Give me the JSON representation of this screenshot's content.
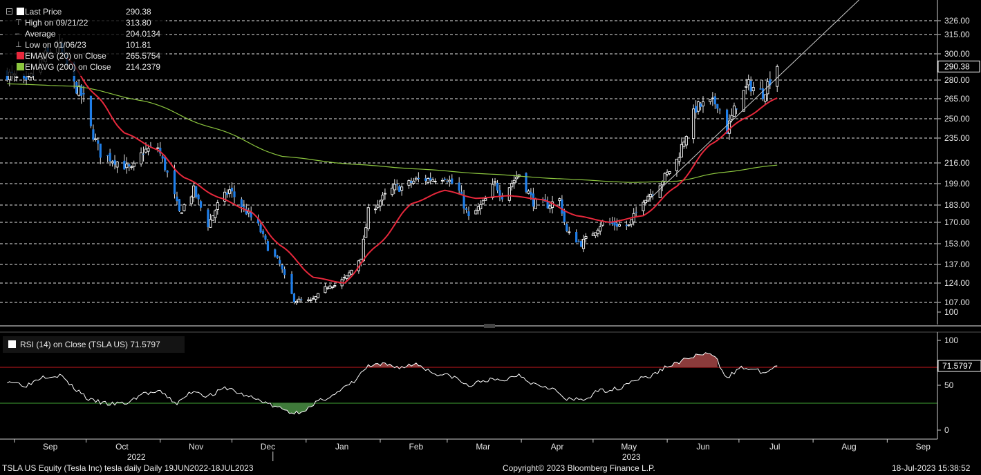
{
  "chart_data": [
    {
      "type": "candlestick",
      "series_name": "TSLA US Equity (Tesla Inc) tesla daily",
      "ylim": [
        95,
        336
      ],
      "y_ticks": [
        100,
        107,
        124,
        137,
        153,
        170,
        183,
        199,
        216,
        235,
        250,
        265,
        280,
        300,
        315,
        326
      ],
      "y_tick_labels": [
        "100",
        "107.00",
        "124.00",
        "137.00",
        "153.00",
        "170.00",
        "183.00",
        "199.00",
        "216.00",
        "235.00",
        "250.00",
        "265.00",
        "280.00",
        "300.00",
        "315.00",
        "326.00"
      ],
      "dashed_grid_levels": [
        107,
        124,
        137,
        153,
        170,
        183,
        199,
        216,
        235,
        250,
        265,
        280,
        300,
        315,
        326
      ],
      "last_price_label": "290.38",
      "legend": [
        {
          "label": "Last Price",
          "value": "290.38",
          "color": "#ffffff"
        },
        {
          "label": "High on 09/21/22",
          "value": "313.80"
        },
        {
          "label": "Average",
          "value": "204.0134"
        },
        {
          "label": "Low on 01/06/23",
          "value": "101.81"
        },
        {
          "label": "EMAVG (20)  on Close",
          "value": "265.5754",
          "color": "#e8283c"
        },
        {
          "label": "EMAVG (200)  on Close",
          "value": "214.2379",
          "color": "#8cc63f"
        }
      ],
      "close_anchors": [
        [
          "2022-08-29",
          285
        ],
        [
          "2022-09-06",
          276
        ],
        [
          "2022-09-13",
          296
        ],
        [
          "2022-09-19",
          308
        ],
        [
          "2022-09-21",
          300
        ],
        [
          "2022-09-26",
          276
        ],
        [
          "2022-09-30",
          265
        ],
        [
          "2022-10-03",
          242
        ],
        [
          "2022-10-07",
          223
        ],
        [
          "2022-10-13",
          218
        ],
        [
          "2022-10-20",
          210
        ],
        [
          "2022-10-25",
          225
        ],
        [
          "2022-10-31",
          228
        ],
        [
          "2022-11-04",
          207
        ],
        [
          "2022-11-09",
          177
        ],
        [
          "2022-11-15",
          194
        ],
        [
          "2022-11-21",
          168
        ],
        [
          "2022-11-25",
          183
        ],
        [
          "2022-11-30",
          194
        ],
        [
          "2022-12-06",
          180
        ],
        [
          "2022-12-12",
          167
        ],
        [
          "2022-12-16",
          150
        ],
        [
          "2022-12-21",
          137
        ],
        [
          "2022-12-27",
          109
        ],
        [
          "2023-01-03",
          108
        ],
        [
          "2023-01-06",
          113
        ],
        [
          "2023-01-11",
          123
        ],
        [
          "2023-01-13",
          122
        ],
        [
          "2023-01-18",
          128
        ],
        [
          "2023-01-24",
          143
        ],
        [
          "2023-01-27",
          178
        ],
        [
          "2023-02-02",
          188
        ],
        [
          "2023-02-07",
          196
        ],
        [
          "2023-02-10",
          196
        ],
        [
          "2023-02-16",
          202
        ],
        [
          "2023-02-23",
          203
        ],
        [
          "2023-02-28",
          205
        ],
        [
          "2023-03-06",
          193
        ],
        [
          "2023-03-10",
          173
        ],
        [
          "2023-03-16",
          184
        ],
        [
          "2023-03-21",
          199
        ],
        [
          "2023-03-24",
          190
        ],
        [
          "2023-03-31",
          207
        ],
        [
          "2023-04-06",
          185
        ],
        [
          "2023-04-12",
          183
        ],
        [
          "2023-04-17",
          187
        ],
        [
          "2023-04-20",
          162
        ],
        [
          "2023-04-26",
          153
        ],
        [
          "2023-05-01",
          162
        ],
        [
          "2023-05-05",
          170
        ],
        [
          "2023-05-11",
          168
        ],
        [
          "2023-05-16",
          167
        ],
        [
          "2023-05-22",
          188
        ],
        [
          "2023-05-26",
          193
        ],
        [
          "2023-06-01",
          207
        ],
        [
          "2023-06-05",
          218
        ],
        [
          "2023-06-08",
          234
        ],
        [
          "2023-06-13",
          258
        ],
        [
          "2023-06-16",
          260
        ],
        [
          "2023-06-22",
          262
        ],
        [
          "2023-06-26",
          241
        ],
        [
          "2023-06-30",
          261
        ],
        [
          "2023-07-05",
          276
        ],
        [
          "2023-07-07",
          274
        ],
        [
          "2023-07-11",
          269
        ],
        [
          "2023-07-13",
          277
        ],
        [
          "2023-07-17",
          290.38
        ]
      ],
      "ema20_anchors": [
        [
          "2022-09-23",
          297
        ],
        [
          "2022-10-05",
          268
        ],
        [
          "2022-10-17",
          239
        ],
        [
          "2022-10-31",
          226
        ],
        [
          "2022-11-11",
          204
        ],
        [
          "2022-11-25",
          189
        ],
        [
          "2022-12-09",
          178
        ],
        [
          "2022-12-21",
          152
        ],
        [
          "2023-01-04",
          128
        ],
        [
          "2023-01-17",
          124
        ],
        [
          "2023-01-31",
          152
        ],
        [
          "2023-02-14",
          184
        ],
        [
          "2023-02-28",
          194
        ],
        [
          "2023-03-13",
          188
        ],
        [
          "2023-03-27",
          190
        ],
        [
          "2023-04-10",
          187
        ],
        [
          "2023-04-24",
          175
        ],
        [
          "2023-05-08",
          170
        ],
        [
          "2023-05-22",
          175
        ],
        [
          "2023-06-05",
          197
        ],
        [
          "2023-06-19",
          230
        ],
        [
          "2023-07-03",
          250
        ],
        [
          "2023-07-17",
          265.5754
        ]
      ],
      "ema200_anchors": [
        [
          "2022-08-29",
          277
        ],
        [
          "2022-09-27",
          275
        ],
        [
          "2022-10-26",
          263
        ],
        [
          "2022-11-23",
          243
        ],
        [
          "2022-12-22",
          221
        ],
        [
          "2023-01-20",
          215
        ],
        [
          "2023-02-17",
          211
        ],
        [
          "2023-03-17",
          207
        ],
        [
          "2023-04-17",
          203
        ],
        [
          "2023-05-17",
          200
        ],
        [
          "2023-06-05",
          201
        ],
        [
          "2023-06-23",
          208
        ],
        [
          "2023-07-17",
          214.2379
        ]
      ],
      "trendline": [
        [
          "2023-05-22",
          183
        ],
        [
          "2023-07-17",
          282
        ],
        [
          "2023-08-22",
          345
        ]
      ]
    },
    {
      "type": "line",
      "series_name": "RSI (14)  on Close (TSLA US) 71.5797",
      "ylim": [
        -5,
        105
      ],
      "y_ticks": [
        0,
        50,
        100
      ],
      "y_tick_labels": [
        "0",
        "50",
        "100"
      ],
      "overbought": 70,
      "oversold": 30,
      "last_value_label": "71.5797",
      "anchors": [
        [
          "2022-08-29",
          55
        ],
        [
          "2022-09-06",
          50
        ],
        [
          "2022-09-13",
          60
        ],
        [
          "2022-09-20",
          61
        ],
        [
          "2022-09-27",
          45
        ],
        [
          "2022-10-03",
          33
        ],
        [
          "2022-10-11",
          29
        ],
        [
          "2022-10-18",
          30
        ],
        [
          "2022-10-25",
          41
        ],
        [
          "2022-11-01",
          42
        ],
        [
          "2022-11-08",
          30
        ],
        [
          "2022-11-15",
          44
        ],
        [
          "2022-11-21",
          38
        ],
        [
          "2022-11-29",
          47
        ],
        [
          "2022-12-06",
          39
        ],
        [
          "2022-12-13",
          33
        ],
        [
          "2022-12-20",
          25
        ],
        [
          "2022-12-27",
          19
        ],
        [
          "2023-01-03",
          25
        ],
        [
          "2023-01-06",
          32
        ],
        [
          "2023-01-13",
          40
        ],
        [
          "2023-01-20",
          52
        ],
        [
          "2023-01-27",
          71
        ],
        [
          "2023-02-03",
          73
        ],
        [
          "2023-02-10",
          70
        ],
        [
          "2023-02-16",
          74
        ],
        [
          "2023-02-24",
          63
        ],
        [
          "2023-03-03",
          60
        ],
        [
          "2023-03-10",
          49
        ],
        [
          "2023-03-17",
          56
        ],
        [
          "2023-03-24",
          55
        ],
        [
          "2023-03-31",
          62
        ],
        [
          "2023-04-06",
          52
        ],
        [
          "2023-04-13",
          48
        ],
        [
          "2023-04-20",
          34
        ],
        [
          "2023-04-27",
          34
        ],
        [
          "2023-05-04",
          44
        ],
        [
          "2023-05-11",
          46
        ],
        [
          "2023-05-18",
          56
        ],
        [
          "2023-05-25",
          60
        ],
        [
          "2023-06-01",
          71
        ],
        [
          "2023-06-08",
          78
        ],
        [
          "2023-06-14",
          84
        ],
        [
          "2023-06-20",
          84
        ],
        [
          "2023-06-26",
          60
        ],
        [
          "2023-07-03",
          70
        ],
        [
          "2023-07-07",
          67
        ],
        [
          "2023-07-12",
          64
        ],
        [
          "2023-07-17",
          71.5797
        ]
      ]
    }
  ],
  "x_axis": {
    "month_labels": [
      {
        "label": "Sep",
        "date": "2022-09-01"
      },
      {
        "label": "Oct",
        "date": "2022-10-01"
      },
      {
        "label": "Nov",
        "date": "2022-11-01"
      },
      {
        "label": "Dec",
        "date": "2022-12-01"
      },
      {
        "label": "Jan",
        "date": "2023-01-01"
      },
      {
        "label": "Feb",
        "date": "2023-02-01"
      },
      {
        "label": "Mar",
        "date": "2023-03-01"
      },
      {
        "label": "Apr",
        "date": "2023-04-01"
      },
      {
        "label": "May",
        "date": "2023-05-01"
      },
      {
        "label": "Jun",
        "date": "2023-06-01"
      },
      {
        "label": "Jul",
        "date": "2023-07-01"
      },
      {
        "label": "Aug",
        "date": "2023-08-01"
      },
      {
        "label": "Sep",
        "date": "2023-09-01"
      }
    ],
    "year_labels": [
      {
        "label": "2022",
        "date": "2022-10-22"
      },
      {
        "label": "2023",
        "date": "2023-05-17"
      }
    ],
    "start_date": "2022-08-26",
    "end_date": "2023-09-22"
  },
  "footer": {
    "left": "TSLA US Equity (Tesla Inc) tesla daily  Daily 19JUN2022-18JUL2023",
    "center": "Copyright© 2023 Bloomberg Finance L.P.",
    "right": "18-Jul-2023 15:38:52"
  },
  "colors": {
    "up_candle": "#ffffff",
    "down_candle": "#1f7ee8",
    "ema20": "#e8283c",
    "ema200": "#8cc63f",
    "trendline": "#cfcfcf",
    "rsi_line": "#ffffff",
    "overbought_line": "#c8191e",
    "oversold_line": "#3fa535"
  }
}
